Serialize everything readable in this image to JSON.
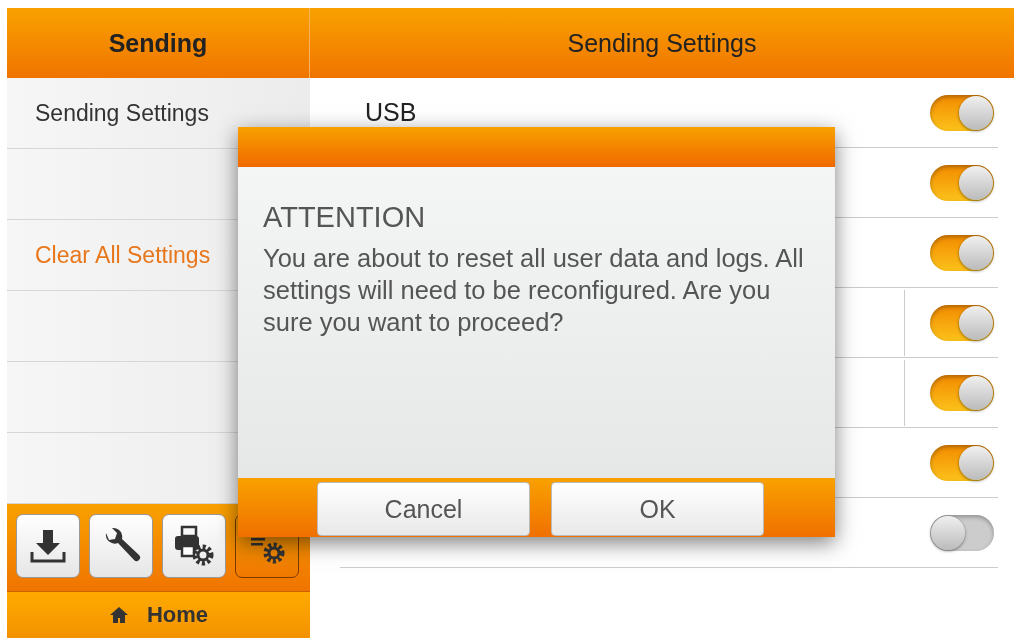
{
  "sidebar": {
    "title": "Sending",
    "items": [
      {
        "kind": "entry",
        "label": "Sending Settings",
        "selected": false
      },
      {
        "kind": "blank"
      },
      {
        "kind": "entry",
        "label": "Clear All Settings",
        "selected": true
      },
      {
        "kind": "blank"
      },
      {
        "kind": "blank"
      },
      {
        "kind": "blank"
      }
    ]
  },
  "toolbar": [
    {
      "kind": "download",
      "selected": false
    },
    {
      "kind": "wrench",
      "selected": false
    },
    {
      "kind": "printer-gear",
      "selected": false
    },
    {
      "kind": "list-gear",
      "selected": true
    }
  ],
  "home": {
    "label": "Home"
  },
  "panel": {
    "title": "Sending Settings",
    "rows": [
      {
        "label": "USB",
        "on": true,
        "divider": false
      },
      {
        "on": true,
        "divider": false
      },
      {
        "on": true,
        "divider": false
      },
      {
        "on": true,
        "divider": true
      },
      {
        "on": true,
        "divider": true
      },
      {
        "on": true,
        "divider": false
      },
      {
        "on": false,
        "divider": false
      }
    ]
  },
  "dialog": {
    "title": "ATTENTION",
    "message": "You are about to reset all user data and logs. All settings will need to be reconfigured. Are you sure you want to proceed?",
    "buttons": [
      "Cancel",
      "OK"
    ]
  }
}
